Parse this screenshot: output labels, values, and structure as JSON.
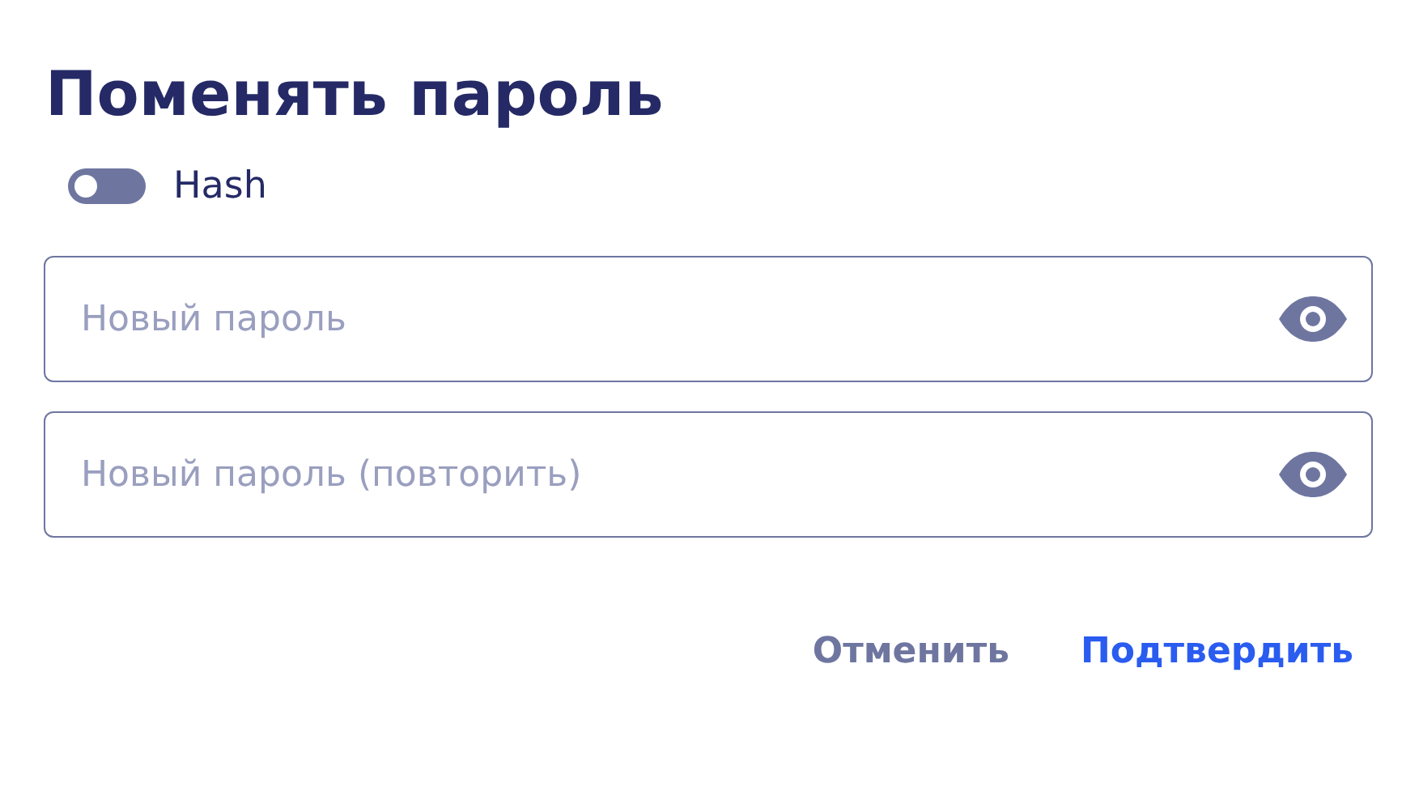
{
  "title": "Поменять пароль",
  "hash_toggle": {
    "label": "Hash",
    "on": false
  },
  "fields": [
    {
      "placeholder": "Новый пароль"
    },
    {
      "placeholder": "Новый пароль (повторить)"
    }
  ],
  "buttons": [
    {
      "label": "Отменить",
      "kind": "secondary"
    },
    {
      "label": "Подтвердить",
      "kind": "primary"
    }
  ]
}
